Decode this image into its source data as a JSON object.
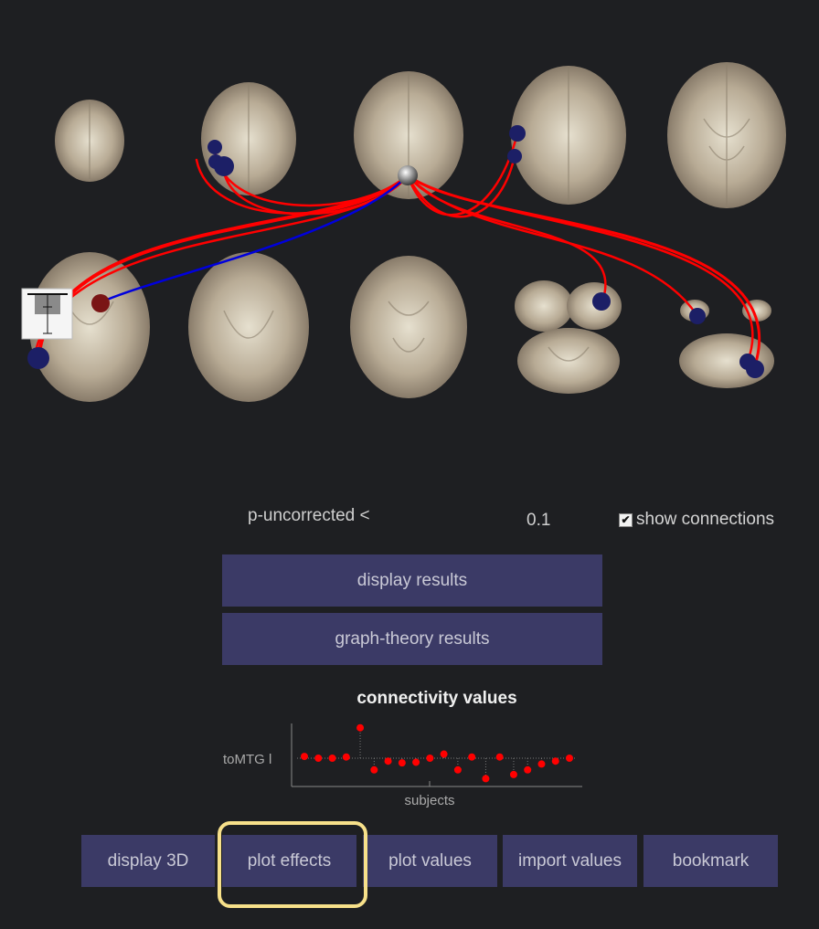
{
  "threshold": {
    "label": "p-uncorrected <",
    "value": "0.1"
  },
  "show_connections": {
    "label": "show connections",
    "checked": true
  },
  "buttons": {
    "display_results": "display results",
    "graph_theory": "graph-theory results"
  },
  "connectivity": {
    "title": "connectivity values",
    "ylabel": "toMTG l",
    "xlabel": "subjects"
  },
  "chart_data": {
    "type": "scatter",
    "title": "connectivity values",
    "xlabel": "subjects",
    "ylabel": "toMTG l",
    "x": [
      1,
      2,
      3,
      4,
      5,
      6,
      7,
      8,
      9,
      10,
      11,
      12,
      13,
      14,
      15,
      16,
      17,
      18,
      19,
      20
    ],
    "values": [
      0.03,
      0.0,
      0.0,
      0.02,
      0.52,
      -0.2,
      -0.05,
      -0.08,
      -0.07,
      0.0,
      0.07,
      -0.2,
      0.02,
      -0.35,
      0.02,
      -0.28,
      -0.2,
      -0.1,
      -0.05,
      0.0
    ],
    "baseline": 0
  },
  "bottom_buttons": {
    "display_3d": "display 3D",
    "plot_effects": "plot effects",
    "plot_values": "plot values",
    "import_values": "import values",
    "bookmark": "bookmark"
  },
  "colors": {
    "background": "#1e1f22",
    "button": "#3b3a66",
    "positive_connection": "#ff0000",
    "negative_connection": "#0000dd",
    "node": "#1c1f66",
    "highlight": "#f7e08a"
  }
}
